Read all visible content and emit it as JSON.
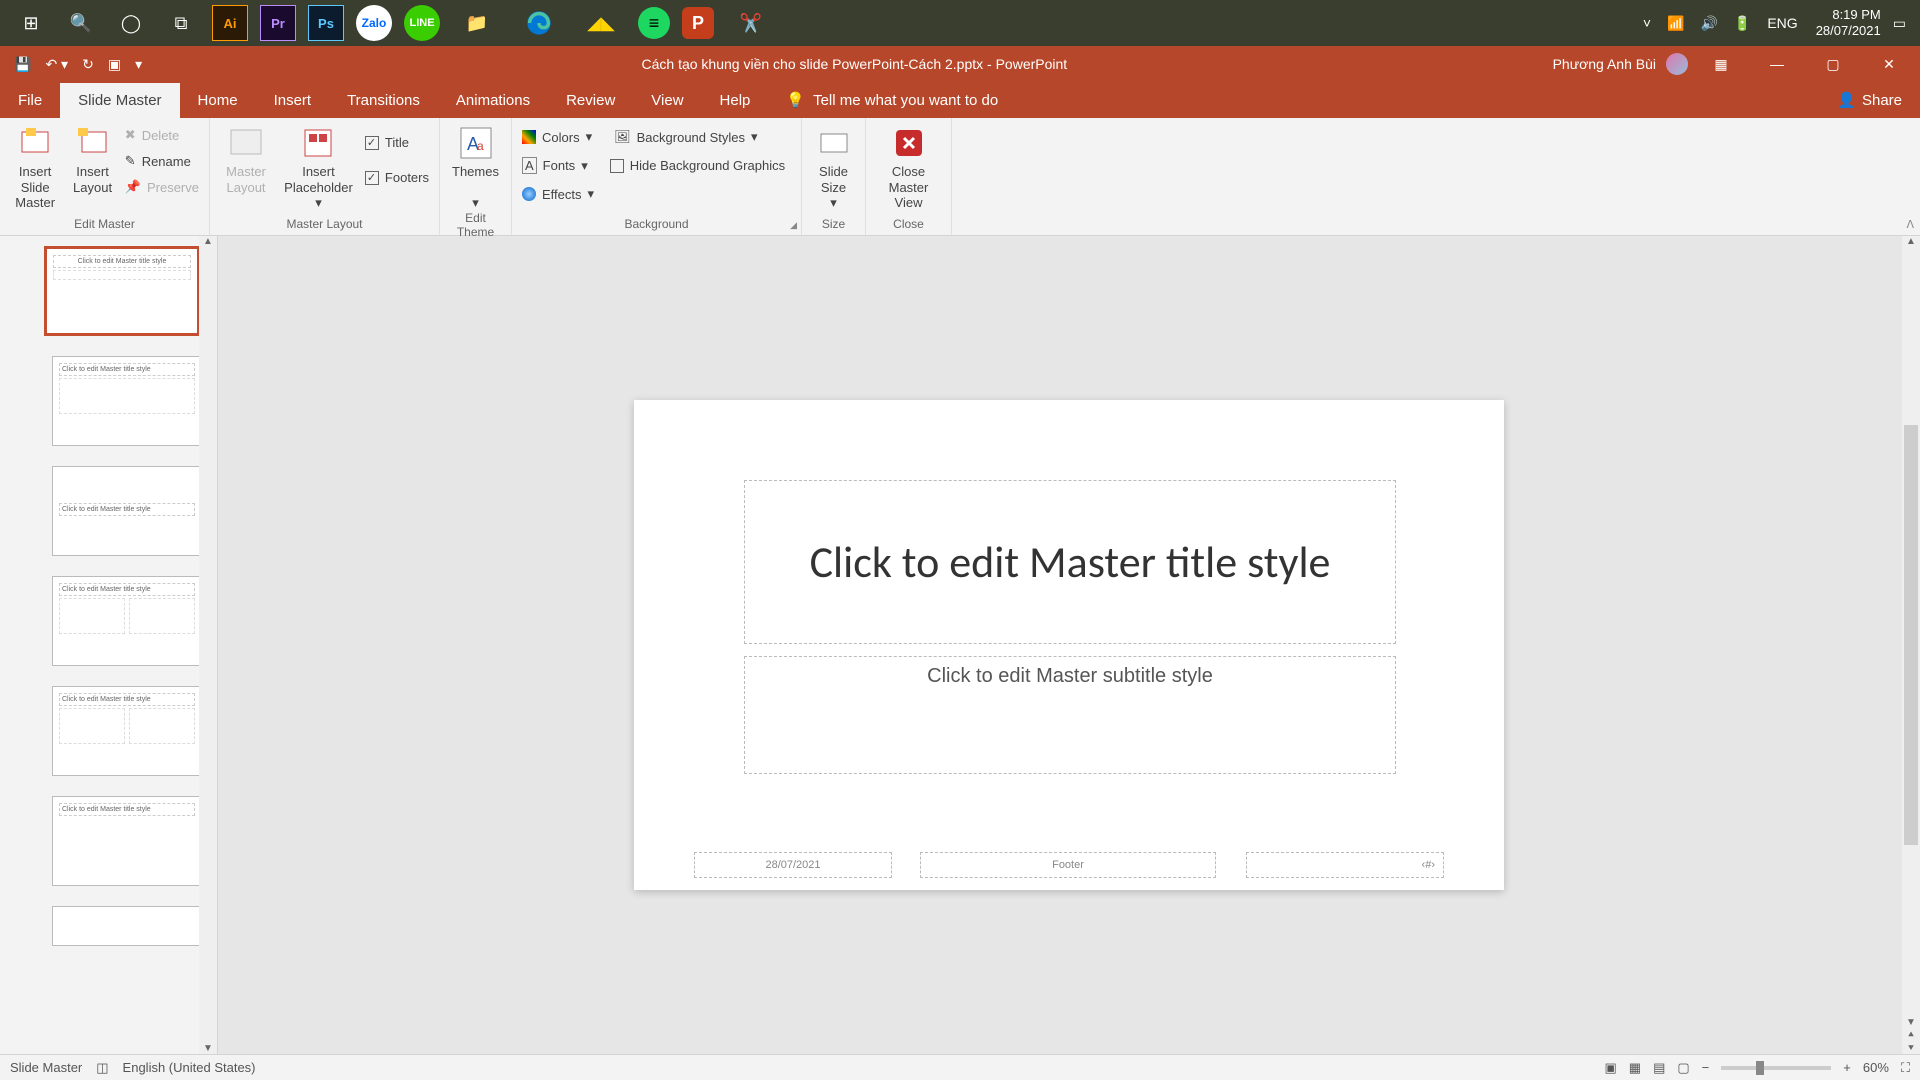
{
  "taskbar": {
    "time": "8:19 PM",
    "date": "28/07/2021",
    "lang": "ENG"
  },
  "title": {
    "filename": "Cách tạo khung viền cho slide PowerPoint-Cách 2.pptx  -  PowerPoint",
    "user": "Phương Anh Bùi"
  },
  "tabs": {
    "file": "File",
    "slideMaster": "Slide Master",
    "home": "Home",
    "insert": "Insert",
    "transitions": "Transitions",
    "animations": "Animations",
    "review": "Review",
    "view": "View",
    "help": "Help",
    "tellMe": "Tell me what you want to do",
    "share": "Share"
  },
  "ribbon": {
    "editMaster": {
      "insertSlideMaster": "Insert Slide Master",
      "insertLayout": "Insert Layout",
      "delete": "Delete",
      "rename": "Rename",
      "preserve": "Preserve",
      "label": "Edit Master"
    },
    "masterLayout": {
      "masterLayout": "Master Layout",
      "insertPlaceholder": "Insert Placeholder",
      "title": "Title",
      "footers": "Footers",
      "label": "Master Layout"
    },
    "editTheme": {
      "themes": "Themes",
      "label": "Edit Theme"
    },
    "background": {
      "colors": "Colors",
      "fonts": "Fonts",
      "effects": "Effects",
      "bgStyles": "Background Styles",
      "hideBg": "Hide Background Graphics",
      "label": "Background"
    },
    "size": {
      "slideSize": "Slide Size",
      "label": "Size"
    },
    "close": {
      "closeMaster": "Close Master View",
      "label": "Close"
    }
  },
  "slide": {
    "title": "Click to edit Master title style",
    "subtitle": "Click to edit Master subtitle style",
    "date": "28/07/2021",
    "footer": "Footer",
    "num": "‹#›"
  },
  "thumbs": {
    "t": "Click to edit Master title style"
  },
  "status": {
    "mode": "Slide Master",
    "lang": "English (United States)",
    "zoom": "60%"
  }
}
